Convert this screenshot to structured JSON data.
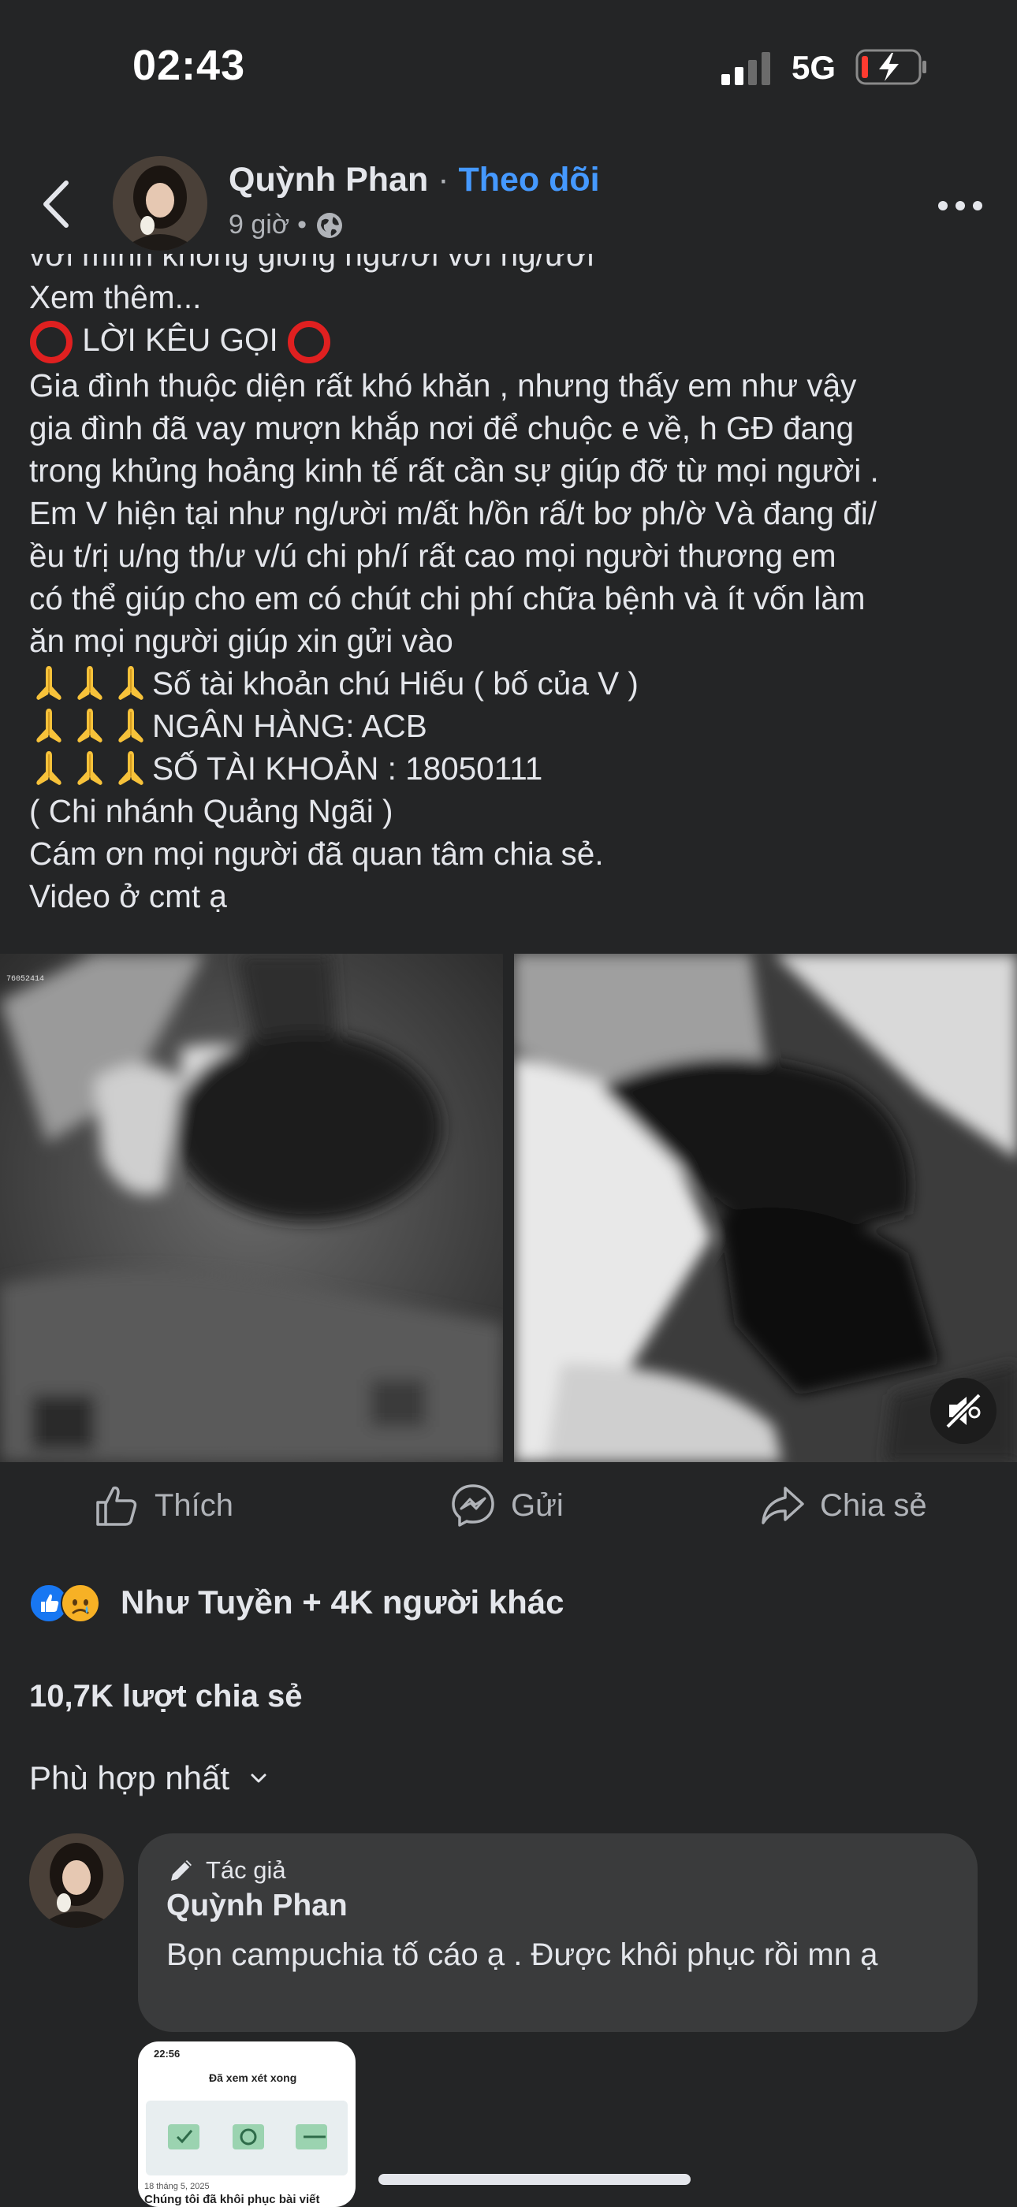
{
  "status_bar": {
    "time": "02:43",
    "network": "5G"
  },
  "header": {
    "author_name": "Quỳnh Phan",
    "separator": "·",
    "follow_label": "Theo dõi",
    "time_ago": "9 giờ",
    "meta_dot": "•"
  },
  "post": {
    "lines": [
      "với mình không giống ngừ/ơi với ng/ười",
      "Xem thêm...",
      "LỜI KÊU GỌI",
      "Gia đình thuộc diện rất khó khăn , nhưng thấy em như vậy",
      "gia đình đã vay mượn khắp nơi để chuộc e về, h GĐ đang",
      "trong khủng hoảng kinh tế rất cần sự giúp đỡ từ mọi người .",
      "Em V hiện tại như ng/ười m/ất h/ồn rấ/t bơ ph/ờ  Và đang đi/",
      "ều t/rị u/ng th/ư v/ú chi ph/í rất cao mọi người thương em",
      "có thể giúp cho em có chút chi phí chữa bệnh và ít vốn làm",
      "ăn mọi người giúp xin gửi vào",
      "Số tài khoản chú Hiếu ( bố của V )",
      "NGÂN HÀNG: ACB",
      "SỐ TÀI KHOẢN : 18050111",
      "( Chi nhánh Quảng Ngãi )",
      "Cám ơn mọi người đã quan tâm chia sẻ.",
      "Video ở cmt ạ"
    ],
    "video_label": "76052414"
  },
  "actions": {
    "like": "Thích",
    "send": "Gửi",
    "share": "Chia sẻ"
  },
  "reactions": {
    "summary": "Như Tuyền + 4K người khác"
  },
  "shares": "10,7K lượt chia sẻ",
  "sort": "Phù hợp nhất",
  "comment": {
    "author_tag": "Tác giả",
    "name": "Quỳnh Phan",
    "text": "Bọn campuchia tố cáo ạ . Được khôi phục rồi mn ạ",
    "attachment": {
      "time": "22:56",
      "title": "Đã xem xét xong",
      "date": "18 tháng 5, 2025",
      "caption": "Chúng tôi đã khôi phục bài viết"
    }
  },
  "colors": {
    "background": "#242526",
    "link_blue": "#4599ff",
    "secondary_text": "#b0b3b8",
    "bubble": "#3a3b3c",
    "red_circle": "#e02020"
  }
}
